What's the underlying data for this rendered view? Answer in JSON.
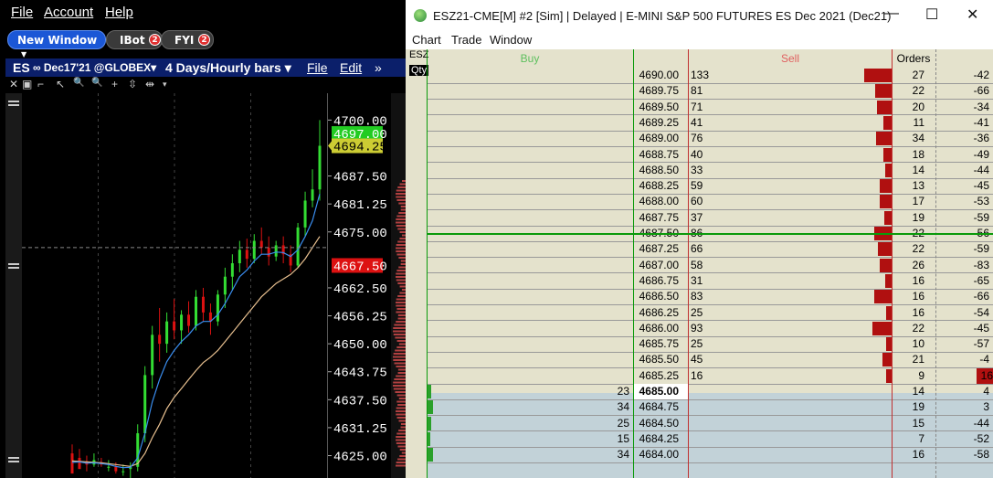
{
  "left_window": {
    "menu": [
      "File",
      "Account",
      "Help"
    ],
    "toolbar": {
      "new_window": "New Window",
      "new_window_caret": "▼",
      "ibot": "IBot",
      "ibot_badge": "2",
      "fyi": "FYI",
      "fyi_badge": "2"
    },
    "chart_header": {
      "symbol": "ES",
      "contract": "∞ Dec17'21 @GLOBEX▾",
      "timeframe": "4 Days/Hourly bars ▾",
      "file": "File",
      "edit": "Edit",
      "more": "»"
    },
    "chart_tools": [
      "✕",
      "▣",
      "⌐",
      "↖",
      "🔍",
      "🔍",
      "+",
      "⇳",
      "⇹",
      "▾"
    ],
    "price_axis": {
      "ticks": [
        "4700.00",
        "4687.50",
        "4681.25",
        "4675.00",
        "4662.50",
        "4656.25",
        "4650.00",
        "4643.75",
        "4637.50",
        "4631.25",
        "4625.00"
      ],
      "ask_label": "4697.00",
      "last_label": "4694.25",
      "bid_label": "4667.50"
    },
    "colors": {
      "up_bar": "#33dd33",
      "down_bar": "#dd1111",
      "ma_fast": "#3a8ef0",
      "ma_slow": "#e8c090",
      "ask_bg": "#22cc22",
      "last_bg": "#cccc33",
      "bid_bg": "#dd1111"
    }
  },
  "chart_data": {
    "type": "candlestick",
    "yrange": [
      4620,
      4706
    ],
    "candles": [
      [
        4625.5,
        4627.5,
        4622.0,
        4621.0
      ],
      [
        4624.5,
        4626.5,
        4623.5,
        4622.0
      ],
      [
        4623.5,
        4625.0,
        4621.5,
        4623.0
      ],
      [
        4623.0,
        4625.5,
        4622.5,
        4624.0
      ],
      [
        4623.5,
        4624.5,
        4622.5,
        4623.0
      ],
      [
        4622.5,
        4624.0,
        4621.5,
        4622.5
      ],
      [
        4622.5,
        4623.5,
        4621.0,
        4621.5
      ],
      [
        4621.5,
        4623.0,
        4620.5,
        4621.5
      ],
      [
        4622.0,
        4623.5,
        4620.0,
        4622.5
      ],
      [
        4622.5,
        4632.0,
        4621.5,
        4630.0
      ],
      [
        4630.0,
        4645.0,
        4628.0,
        4643.0
      ],
      [
        4643.0,
        4654.0,
        4640.0,
        4652.0
      ],
      [
        4652.0,
        4658.0,
        4646.0,
        4650.0
      ],
      [
        4650.0,
        4657.0,
        4648.0,
        4655.0
      ],
      [
        4655.0,
        4660.0,
        4651.0,
        4653.0
      ],
      [
        4653.0,
        4657.5,
        4650.0,
        4656.5
      ],
      [
        4656.5,
        4659.5,
        4652.5,
        4654.0
      ],
      [
        4654.0,
        4662.0,
        4653.0,
        4660.5
      ],
      [
        4660.5,
        4662.5,
        4655.0,
        4657.0
      ],
      [
        4657.0,
        4659.0,
        4652.0,
        4655.0
      ],
      [
        4655.0,
        4662.0,
        4654.0,
        4661.0
      ],
      [
        4661.0,
        4667.0,
        4658.0,
        4665.0
      ],
      [
        4665.0,
        4670.0,
        4662.0,
        4668.0
      ],
      [
        4668.0,
        4673.0,
        4666.0,
        4671.0
      ],
      [
        4671.0,
        4673.5,
        4667.0,
        4669.0
      ],
      [
        4669.0,
        4674.5,
        4668.0,
        4673.0
      ],
      [
        4673.0,
        4676.0,
        4670.0,
        4671.5
      ],
      [
        4671.5,
        4674.0,
        4667.5,
        4669.5
      ],
      [
        4669.5,
        4673.0,
        4668.5,
        4672.0
      ],
      [
        4672.0,
        4674.0,
        4668.0,
        4670.0
      ],
      [
        4670.0,
        4672.0,
        4666.0,
        4667.5
      ],
      [
        4667.5,
        4677.0,
        4667.0,
        4676.0
      ],
      [
        4676.0,
        4684.0,
        4674.0,
        4682.0
      ],
      [
        4682.0,
        4689.0,
        4680.5,
        4684.5
      ],
      [
        4684.5,
        4700.0,
        4682.0,
        4694.25
      ]
    ],
    "ma_fast": [
      4623.5,
      4623.6,
      4623.3,
      4623.4,
      4623.2,
      4623.0,
      4622.6,
      4622.3,
      4622.4,
      4624.5,
      4630.0,
      4637.0,
      4642.0,
      4646.0,
      4648.5,
      4650.5,
      4652.0,
      4654.0,
      4655.0,
      4655.0,
      4656.5,
      4659.0,
      4662.0,
      4665.0,
      4666.5,
      4668.5,
      4670.0,
      4670.0,
      4670.5,
      4670.4,
      4669.5,
      4671.0,
      4674.0,
      4677.5,
      4683.5
    ],
    "ma_slow": [
      4623.8,
      4623.7,
      4623.6,
      4623.5,
      4623.4,
      4623.2,
      4623.0,
      4622.8,
      4622.6,
      4623.2,
      4625.5,
      4629.0,
      4632.0,
      4635.5,
      4638.0,
      4640.0,
      4642.0,
      4644.0,
      4645.8,
      4647.0,
      4648.5,
      4650.5,
      4652.5,
      4654.5,
      4656.5,
      4658.5,
      4660.5,
      4662.0,
      4663.5,
      4664.5,
      4665.5,
      4667.0,
      4669.0,
      4671.5,
      4674.0
    ]
  },
  "right_window": {
    "title": "ESZ21-CME[M]  #2 [Sim]  | Delayed | E-MINI S&P 500 FUTURES ES Dec 2021 (Dec21)",
    "controls": {
      "minimize": "—",
      "maximize": "☐",
      "close": "✕"
    },
    "menu": [
      "Chart",
      "Trade",
      "Window"
    ],
    "ladder": {
      "headers": {
        "buy": "Buy",
        "sell": "Sell",
        "orders": "Orders"
      },
      "side_labels": [
        "ESZ",
        "Qty"
      ],
      "colors": {
        "bg_ask": "#e4e2cc",
        "bg_bid": "#c2d2d8",
        "bar": "#b01010",
        "buy_bar": "#2aa02a",
        "inside_line": "#0a9a0a",
        "buy_header": "#5fc05f",
        "sell_header": "#e06060"
      },
      "rows": [
        {
          "price": "4690.00",
          "buy": "",
          "sell": "133",
          "orders": "27",
          "delta": "-42",
          "sell_frac": 1.0
        },
        {
          "price": "4689.75",
          "buy": "",
          "sell": "81",
          "orders": "22",
          "delta": "-66",
          "sell_frac": 0.61
        },
        {
          "price": "4689.50",
          "buy": "",
          "sell": "71",
          "orders": "20",
          "delta": "-34",
          "sell_frac": 0.53
        },
        {
          "price": "4689.25",
          "buy": "",
          "sell": "41",
          "orders": "11",
          "delta": "-41",
          "sell_frac": 0.31
        },
        {
          "price": "4689.00",
          "buy": "",
          "sell": "76",
          "orders": "34",
          "delta": "-36",
          "sell_frac": 0.57
        },
        {
          "price": "4688.75",
          "buy": "",
          "sell": "40",
          "orders": "18",
          "delta": "-49",
          "sell_frac": 0.3
        },
        {
          "price": "4688.50",
          "buy": "",
          "sell": "33",
          "orders": "14",
          "delta": "-44",
          "sell_frac": 0.25
        },
        {
          "price": "4688.25",
          "buy": "",
          "sell": "59",
          "orders": "13",
          "delta": "-45",
          "sell_frac": 0.44
        },
        {
          "price": "4688.00",
          "buy": "",
          "sell": "60",
          "orders": "17",
          "delta": "-53",
          "sell_frac": 0.45
        },
        {
          "price": "4687.75",
          "buy": "",
          "sell": "37",
          "orders": "19",
          "delta": "-59",
          "sell_frac": 0.28
        },
        {
          "price": "4687.50",
          "buy": "",
          "sell": "86",
          "orders": "22",
          "delta": "-56",
          "sell_frac": 0.65
        },
        {
          "price": "4687.25",
          "buy": "",
          "sell": "66",
          "orders": "22",
          "delta": "-59",
          "sell_frac": 0.5
        },
        {
          "price": "4687.00",
          "buy": "",
          "sell": "58",
          "orders": "26",
          "delta": "-83",
          "sell_frac": 0.44
        },
        {
          "price": "4686.75",
          "buy": "",
          "sell": "31",
          "orders": "16",
          "delta": "-65",
          "sell_frac": 0.23
        },
        {
          "price": "4686.50",
          "buy": "",
          "sell": "83",
          "orders": "16",
          "delta": "-66",
          "sell_frac": 0.62
        },
        {
          "price": "4686.25",
          "buy": "",
          "sell": "25",
          "orders": "16",
          "delta": "-54",
          "sell_frac": 0.19
        },
        {
          "price": "4686.00",
          "buy": "",
          "sell": "93",
          "orders": "22",
          "delta": "-45",
          "sell_frac": 0.7
        },
        {
          "price": "4685.75",
          "buy": "",
          "sell": "25",
          "orders": "10",
          "delta": "-57",
          "sell_frac": 0.19
        },
        {
          "price": "4685.50",
          "buy": "",
          "sell": "45",
          "orders": "21",
          "delta": "-4",
          "sell_frac": 0.34
        },
        {
          "price": "4685.25",
          "buy": "",
          "sell": "16",
          "orders": "9",
          "delta": "16",
          "sell_frac": 0.12
        },
        {
          "price": "4685.00",
          "buy": "23",
          "sell": "",
          "orders": "14",
          "delta": "4",
          "buy_frac": 0.68
        },
        {
          "price": "4684.75",
          "buy": "34",
          "sell": "",
          "orders": "19",
          "delta": "3",
          "buy_frac": 1.0
        },
        {
          "price": "4684.50",
          "buy": "25",
          "sell": "",
          "orders": "15",
          "delta": "-44",
          "buy_frac": 0.74
        },
        {
          "price": "4684.25",
          "buy": "15",
          "sell": "",
          "orders": "7",
          "delta": "-52",
          "buy_frac": 0.44
        },
        {
          "price": "4684.00",
          "buy": "34",
          "sell": "",
          "orders": "16",
          "delta": "-58",
          "buy_frac": 1.0
        }
      ]
    }
  }
}
